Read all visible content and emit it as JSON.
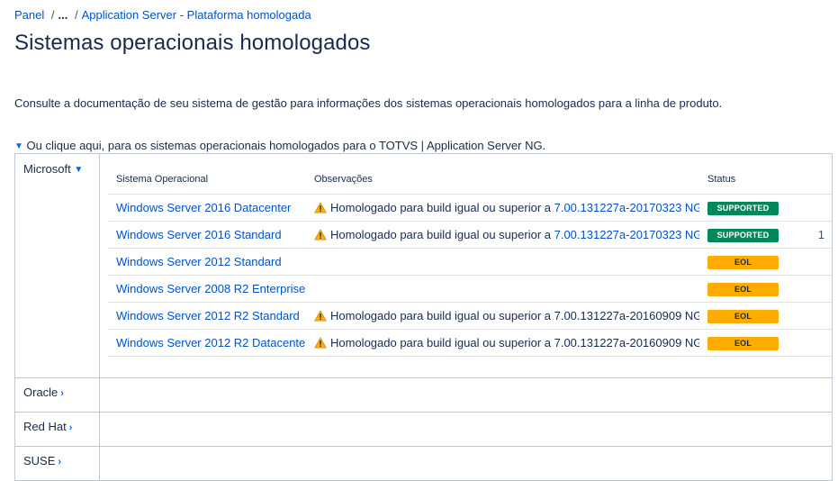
{
  "breadcrumb": {
    "root": "Panel",
    "ellipsis": "...",
    "current": "Application Server - Plataforma homologada"
  },
  "page_title": "Sistemas operacionais homologados",
  "intro_text": "Consulte a documentação de seu sistema de gestão para informações dos sistemas operacionais homologados para a linha de produto.",
  "expand_text": "Ou clique aqui, para os sistemas operacionais homologados para o TOTVS | Application Server NG.",
  "table": {
    "headers": {
      "os": "Sistema Operacional",
      "notes": "Observações",
      "status": "Status"
    },
    "rows": [
      {
        "os": "Windows Server 2016 Datacenter",
        "note_prefix": "Homologado para build igual ou superior a ",
        "note_link": "7.00.131227a-20170323 NG.",
        "note_plain": "",
        "status": "SUPPORTED",
        "extra": ""
      },
      {
        "os": "Windows Server 2016 Standard",
        "note_prefix": "Homologado para build igual ou superior a ",
        "note_link": "7.00.131227a-20170323 NG.",
        "note_plain": "",
        "status": "SUPPORTED",
        "extra": "1"
      },
      {
        "os": "Windows Server 2012 Standard",
        "note_prefix": "",
        "note_link": "",
        "note_plain": "",
        "status": "EOL",
        "extra": ""
      },
      {
        "os": "Windows Server 2008 R2 Enterprise",
        "note_prefix": "",
        "note_link": "",
        "note_plain": "",
        "status": "EOL",
        "extra": ""
      },
      {
        "os": "Windows Server 2012 R2 Standard",
        "note_prefix": "Homologado para build igual ou superior a ",
        "note_link": "",
        "note_plain": "7.00.131227a-20160909 NG.",
        "status": "EOL",
        "extra": ""
      },
      {
        "os": "Windows Server 2012 R2 Datacenter",
        "note_prefix": "Homologado para build igual ou superior a ",
        "note_link": "",
        "note_plain": "7.00.131227a-20160909 NG.",
        "status": "EOL",
        "extra": ""
      }
    ]
  },
  "vendors": {
    "microsoft": "Microsoft",
    "oracle": "Oracle",
    "redhat": "Red Hat",
    "suse": "SUSE"
  },
  "icons": {
    "expand": "chevron-down-icon",
    "collapsed": "chevron-right-icon",
    "warning": "warning-icon"
  },
  "colors": {
    "link": "#0052cc",
    "supported": "#00875a",
    "eol": "#ffab00",
    "chevron": "#0065ff"
  }
}
